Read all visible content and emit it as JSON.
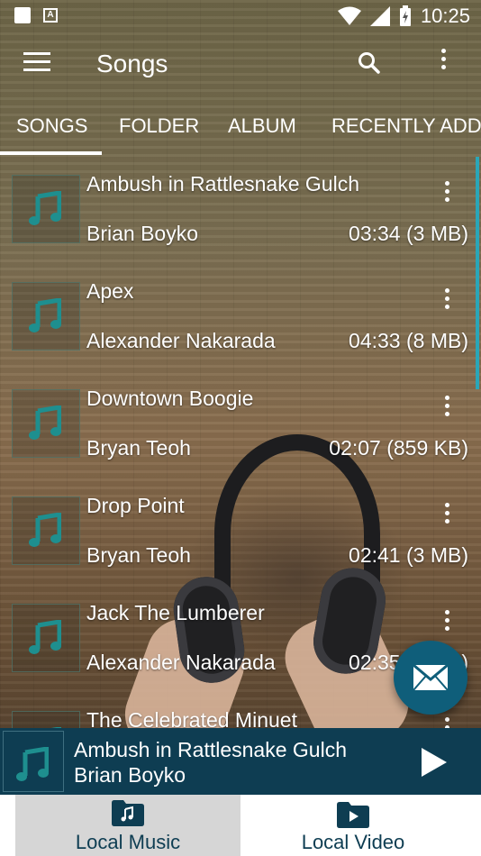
{
  "status_bar": {
    "time": "10:25"
  },
  "toolbar": {
    "title": "Songs"
  },
  "tabs": [
    {
      "label": "SONGS"
    },
    {
      "label": "FOLDER"
    },
    {
      "label": "ALBUM"
    },
    {
      "label": "RECENTLY ADD"
    }
  ],
  "songs": [
    {
      "title": "Ambush in Rattlesnake Gulch",
      "artist": "Brian Boyko",
      "meta": "03:34 (3 MB)"
    },
    {
      "title": "Apex",
      "artist": "Alexander Nakarada",
      "meta": "04:33 (8 MB)"
    },
    {
      "title": "Downtown Boogie",
      "artist": "Bryan Teoh",
      "meta": "02:07 (859 KB)"
    },
    {
      "title": "Drop Point",
      "artist": "Bryan Teoh",
      "meta": "02:41 (3 MB)"
    },
    {
      "title": "Jack The Lumberer",
      "artist": "Alexander Nakarada",
      "meta": "02:35 (3 MB)"
    },
    {
      "title": "The Celebrated Minuet",
      "artist": "",
      "meta": ""
    }
  ],
  "now_playing": {
    "title": "Ambush in Rattlesnake Gulch",
    "artist": "Brian Boyko"
  },
  "bottom_nav": [
    {
      "label": "Local Music"
    },
    {
      "label": "Local Video"
    }
  ],
  "colors": {
    "accent": "#2aa6b8",
    "bar": "#0e3d52",
    "fab": "#0f5e7a",
    "note": "#1e8f8f"
  },
  "icons": {
    "toolbar": [
      "menu-icon",
      "search-icon",
      "more-vert-icon"
    ],
    "fab": "mail-icon",
    "player": [
      "music-note-icon",
      "play-icon"
    ],
    "nav": [
      "music-folder-icon",
      "video-folder-icon"
    ]
  }
}
